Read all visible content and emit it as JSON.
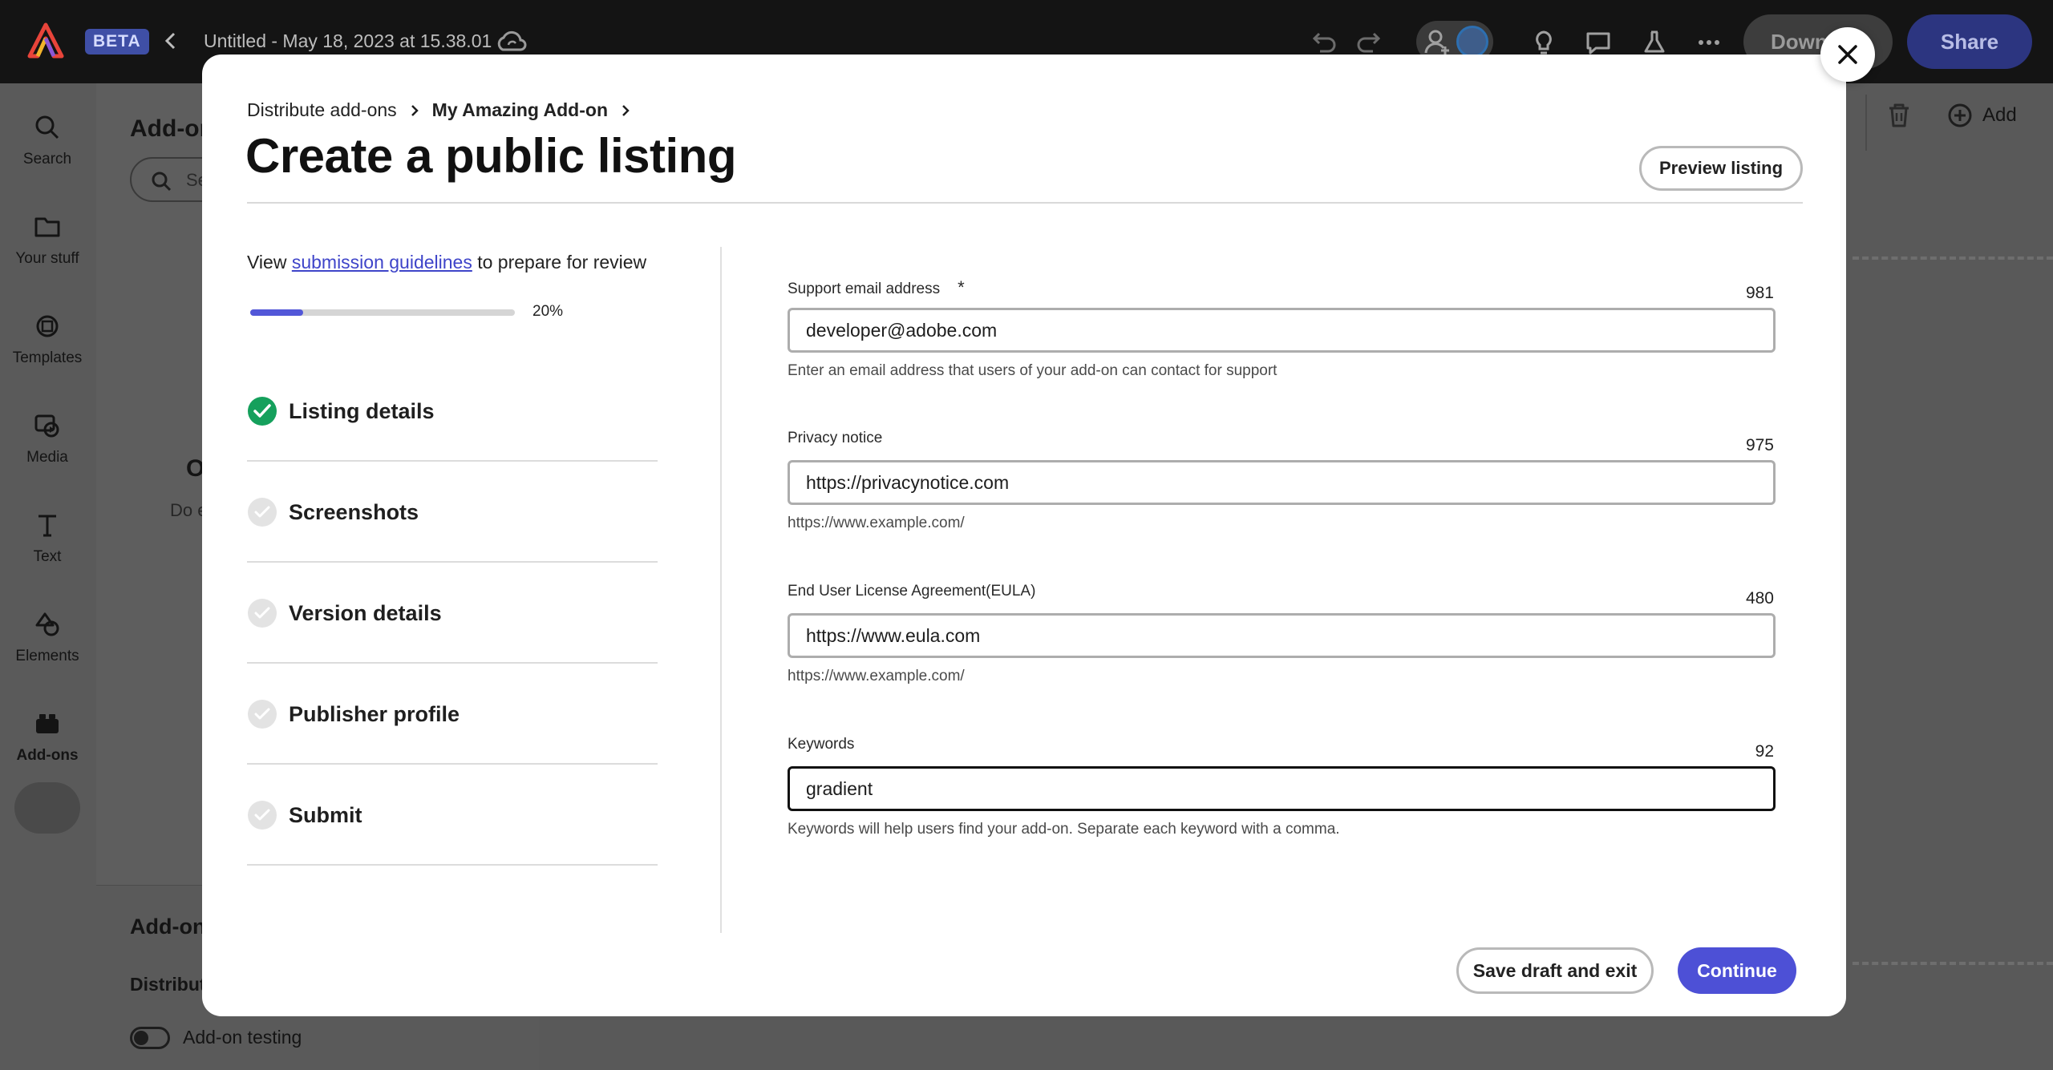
{
  "app": {
    "beta_badge": "BETA",
    "document_title": "Untitled - May 18, 2023 at 15.38.01",
    "download_label": "Down",
    "share_label": "Share"
  },
  "left_rail": {
    "items": [
      {
        "label": "Search",
        "icon": "search-icon"
      },
      {
        "label": "Your stuff",
        "icon": "folder-icon"
      },
      {
        "label": "Templates",
        "icon": "templates-icon"
      },
      {
        "label": "Media",
        "icon": "media-icon"
      },
      {
        "label": "Text",
        "icon": "text-icon"
      },
      {
        "label": "Elements",
        "icon": "elements-icon"
      },
      {
        "label": "Add-ons",
        "icon": "addons-icon"
      }
    ]
  },
  "addons_panel": {
    "title": "Add-on",
    "search_placeholder": "Se",
    "empty_heading": "O",
    "empty_text": "Do e",
    "bottom_title": "Add-on",
    "bottom_subtitle": "Distribut",
    "testing_toggle_label": "Add-on testing"
  },
  "canvas_toolbar": {
    "add_label": "Add"
  },
  "modal": {
    "breadcrumb": [
      "Distribute add-ons",
      "My Amazing Add-on"
    ],
    "title": "Create a public listing",
    "preview_button": "Preview listing",
    "guidelines": {
      "prefix": "View ",
      "link": "submission guidelines",
      "suffix": " to prepare for review"
    },
    "progress": {
      "value": 0.2,
      "label": "20%"
    },
    "steps": [
      {
        "label": "Listing details",
        "completed": true
      },
      {
        "label": "Screenshots",
        "completed": false
      },
      {
        "label": "Version details",
        "completed": false
      },
      {
        "label": "Publisher profile",
        "completed": false
      },
      {
        "label": "Submit",
        "completed": false
      }
    ],
    "fields": {
      "support_email": {
        "label": "Support email address",
        "required_marker": "*",
        "count": "981",
        "value": "developer@adobe.com",
        "help": "Enter an email address that users of your add-on can contact for support"
      },
      "privacy": {
        "label": "Privacy notice",
        "count": "975",
        "value": "https://privacynotice.com",
        "help": "https://www.example.com/"
      },
      "eula": {
        "label": "End User License Agreement(EULA)",
        "count": "480",
        "value": "https://www.eula.com",
        "help": "https://www.example.com/"
      },
      "keywords": {
        "label": "Keywords",
        "count": "92",
        "value": "gradient",
        "help": "Keywords will help users find your add-on. Separate each keyword with a comma."
      }
    },
    "save_draft_button": "Save draft and exit",
    "continue_button": "Continue"
  },
  "colors": {
    "accent": "#4d50d6",
    "link": "#3e44c9",
    "success": "#15a05c",
    "overlay": "#595959"
  }
}
